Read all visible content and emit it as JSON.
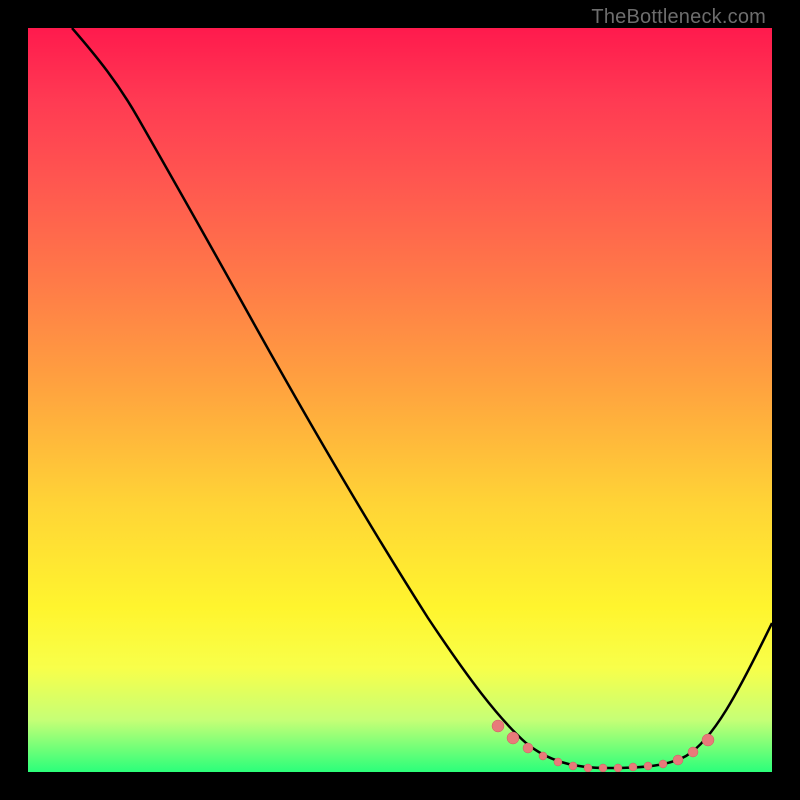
{
  "watermark": "TheBottleneck.com",
  "chart_data": {
    "type": "line",
    "title": "",
    "xlabel": "",
    "ylabel": "",
    "xlim": [
      0,
      100
    ],
    "ylim": [
      0,
      100
    ],
    "background": "rainbow-gradient red-top green-bottom",
    "series": [
      {
        "name": "bottleneck-curve",
        "x": [
          6,
          10,
          14,
          20,
          28,
          36,
          44,
          52,
          58,
          62,
          66,
          70,
          74,
          78,
          82,
          86,
          88,
          92,
          96,
          100
        ],
        "y": [
          100,
          98,
          95,
          90,
          80,
          68,
          56,
          44,
          34,
          26,
          18,
          10,
          5,
          2,
          1,
          1,
          2,
          8,
          16,
          26
        ]
      }
    ],
    "markers": {
      "name": "highlighted-range-dots",
      "x": [
        62,
        64,
        66,
        68,
        70,
        72,
        74,
        76,
        78,
        80,
        82,
        84,
        86,
        88,
        90
      ],
      "y": [
        9,
        8,
        7,
        6,
        5,
        4,
        3.5,
        3,
        2.5,
        2,
        2,
        2,
        2.5,
        3,
        5
      ]
    }
  }
}
